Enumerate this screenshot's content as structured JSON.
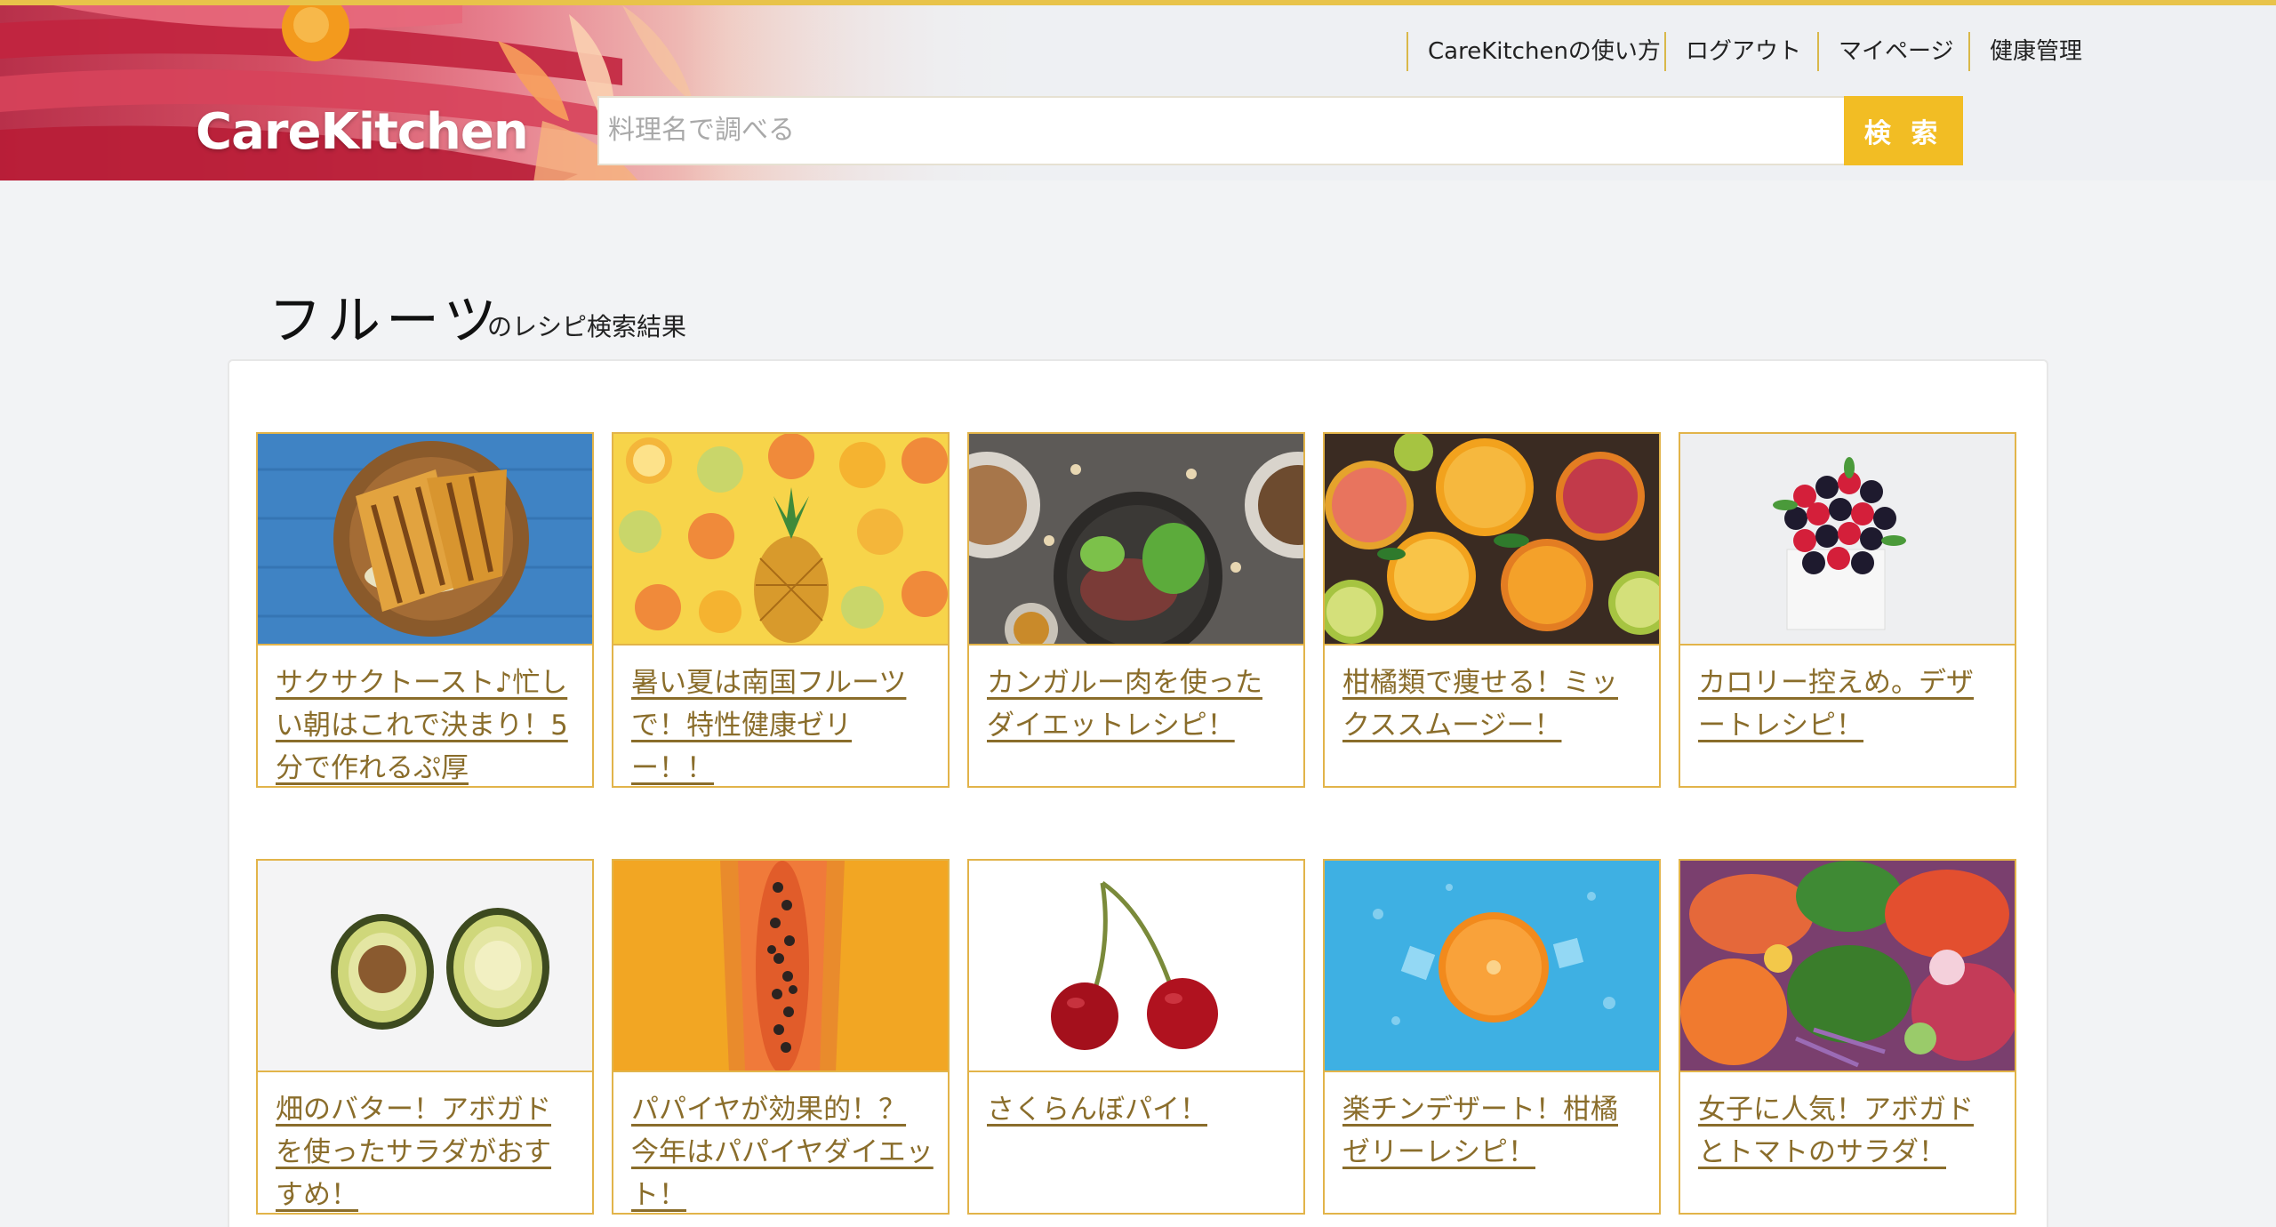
{
  "header": {
    "logo": "CareKitchen",
    "search": {
      "placeholder": "料理名で調べる",
      "button": "検 索"
    },
    "nav": [
      "CareKitchenの使い方",
      "ログアウト",
      "マイページ",
      "健康管理"
    ]
  },
  "results": {
    "keyword": "フルーツ",
    "suffix": "のレシピ検索結果"
  },
  "recipes": [
    {
      "title": "サクサクトースト♪忙しい朝はこれで決まり！5分で作れるぷ厚"
    },
    {
      "title": "暑い夏は南国フルーツで！特性健康ゼリー！！"
    },
    {
      "title": "カンガルー肉を使ったダイエットレシピ！"
    },
    {
      "title": "柑橘類で痩せる！ミックススムージー！"
    },
    {
      "title": "カロリー控えめ。デザートレシピ！"
    },
    {
      "title": "畑のバター！アボガドを使ったサラダがおすすめ！"
    },
    {
      "title": "パパイヤが効果的！？今年はパパイヤダイエット！"
    },
    {
      "title": "さくらんぼパイ！"
    },
    {
      "title": "楽チンデザート！柑橘ゼリーレシピ！"
    },
    {
      "title": "女子に人気！アボガドとトマトのサラダ！"
    }
  ],
  "colors": {
    "accent": "#f2bd24",
    "card_border": "#e2b44a",
    "link": "#8a6d2b"
  }
}
